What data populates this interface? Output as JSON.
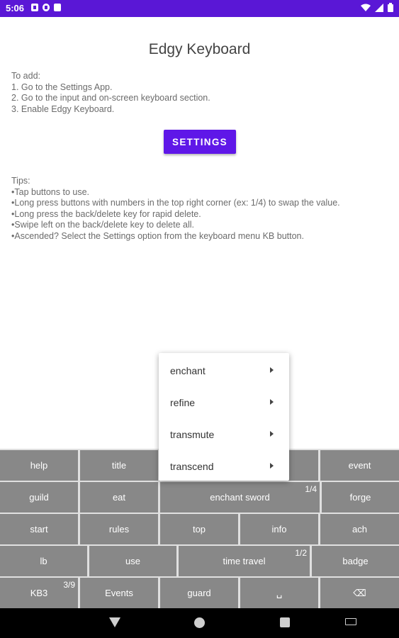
{
  "status_bar": {
    "time": "5:06",
    "left_icons": [
      "notification-icon",
      "notification-icon",
      "notification-icon",
      "sd-card-icon"
    ],
    "right_icons": [
      "wifi-icon",
      "signal-icon",
      "battery-icon"
    ]
  },
  "app": {
    "title": "Edgy Keyboard",
    "instructions": [
      "To add:",
      "1. Go to the Settings App.",
      "2. Go to the input and on-screen keyboard section.",
      "3. Enable Edgy Keyboard."
    ],
    "settings_button": "SETTINGS",
    "tips": [
      "Tips:",
      "•Tap buttons to use.",
      "•Long press buttons with numbers in the top right corner (ex: 1/4) to swap the value.",
      "•Long press the back/delete key for rapid delete.",
      "•Swipe left on the back/delete key to delete all.",
      "•Ascended? Select the Settings option from the keyboard menu KB button."
    ]
  },
  "popup_menu": {
    "items": [
      "enchant",
      "refine",
      "transmute",
      "transcend"
    ]
  },
  "keyboard": {
    "row1": [
      "help",
      "title",
      "",
      "",
      "event"
    ],
    "row2": [
      {
        "label": "guild"
      },
      {
        "label": "eat"
      },
      {
        "label": "enchant sword",
        "sup": "1/4"
      },
      {
        "label": "forge"
      }
    ],
    "row3": [
      "start",
      "rules",
      "top",
      "info",
      "ach"
    ],
    "row4": [
      {
        "label": "lb"
      },
      {
        "label": "use"
      },
      {
        "label": "time travel",
        "sup": "1/2"
      },
      {
        "label": "badge"
      }
    ],
    "row5": [
      {
        "label": "KB3",
        "sup": "3/9"
      },
      {
        "label": "Events"
      },
      {
        "label": "guard"
      },
      {
        "label": "␣"
      },
      {
        "label": "⌫"
      }
    ]
  },
  "colors": {
    "status_bar": "#5a17d6",
    "accent_button": "#5f17e8",
    "key": "#888888",
    "key_gap": "#e0e0e0"
  }
}
